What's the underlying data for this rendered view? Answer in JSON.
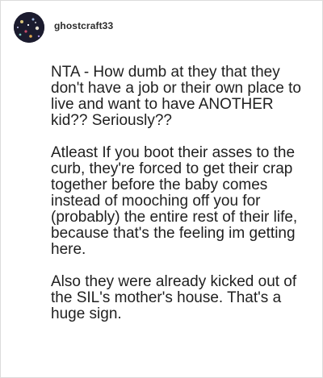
{
  "comment": {
    "author": {
      "username": "ghostcraft33",
      "avatar_icon": "user-avatar-icon"
    },
    "paragraphs": [
      "NTA - How dumb at they that they don't have a job or their own place to live and want to have ANOTHER kid?? Seriously??",
      "Atleast If you boot their asses to the curb, they're forced to get their crap together before the baby comes instead of mooching off you for (probably) the entire rest of their life, because that's the feeling im getting here.",
      "Also they were already kicked out of the SIL's mother's house. That's a huge sign."
    ]
  },
  "colors": {
    "text": "#1f1f1f",
    "username": "#2b2b2b",
    "border": "#dcdcdc",
    "avatar_bg": "#1a1a2a"
  }
}
